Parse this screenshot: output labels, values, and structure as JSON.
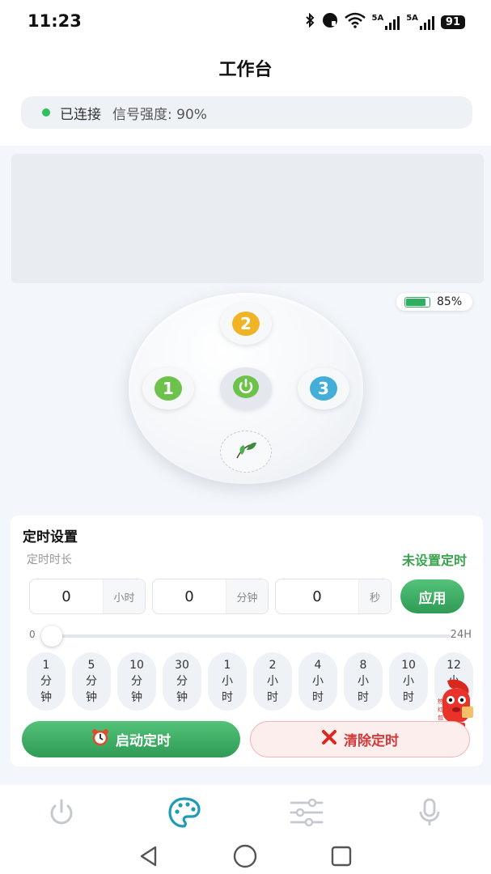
{
  "status_bar": {
    "time": "11:23",
    "net1_label": "5A",
    "net2_label": "5A",
    "battery": "91",
    "icons": [
      "bluetooth-icon",
      "nfc-icon",
      "wifi-icon",
      "signal-icon",
      "signal-icon",
      "battery-icon"
    ]
  },
  "header": {
    "title": "工作台",
    "connection_status": "已连接",
    "signal_strength": "信号强度: 90%",
    "status_color": "#2fbf5c"
  },
  "device": {
    "battery_text": "85%",
    "battery_level": 0.85,
    "buttons": [
      {
        "label": "2",
        "color": "#f0b323"
      },
      {
        "label": "1",
        "color": "#6cc24a"
      },
      {
        "label": "3",
        "color": "#43afd8"
      }
    ],
    "power_color": "#6cc24a"
  },
  "timer": {
    "title": "定时设置",
    "duration_label": "定时时长",
    "status": "未设置定时",
    "hours": {
      "value": "0",
      "unit": "小时"
    },
    "minutes": {
      "value": "0",
      "unit": "分钟"
    },
    "seconds": {
      "value": "0",
      "unit": "秒"
    },
    "apply_label": "应用",
    "slider_min": "0",
    "slider_max": "24H",
    "slider_value": 0,
    "presets": [
      [
        "1",
        "分",
        "钟"
      ],
      [
        "5",
        "分",
        "钟"
      ],
      [
        "10",
        "分",
        "钟"
      ],
      [
        "30",
        "分",
        "钟"
      ],
      [
        "1",
        "小",
        "时"
      ],
      [
        "2",
        "小",
        "时"
      ],
      [
        "4",
        "小",
        "时"
      ],
      [
        "8",
        "小",
        "时"
      ],
      [
        "10",
        "小",
        "时"
      ],
      [
        "12",
        "小",
        "时"
      ]
    ],
    "start_label": "启动定时",
    "clear_label": "清除定时"
  },
  "tabs": [
    {
      "icon": "power-icon",
      "active": false
    },
    {
      "icon": "palette-icon",
      "active": true
    },
    {
      "icon": "sliders-icon",
      "active": false
    },
    {
      "icon": "microphone-icon",
      "active": false
    }
  ],
  "colors": {
    "accent_green": "#2f9b55",
    "active_tab": "#1f9bb5",
    "inactive_tab": "#c4c9cf",
    "danger": "#d23a3a"
  }
}
